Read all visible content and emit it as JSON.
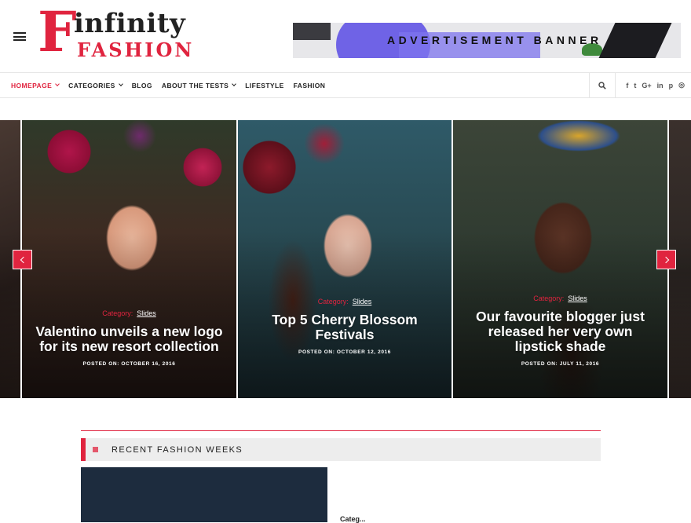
{
  "header": {
    "logo_letter": "F",
    "logo_word1": "infinity",
    "logo_word2": "FASHION",
    "ad_text": "ADVERTISEMENT BANNER"
  },
  "nav": {
    "items": [
      {
        "label": "HOMEPAGE",
        "dropdown": true,
        "active": true
      },
      {
        "label": "CATEGORIES",
        "dropdown": true
      },
      {
        "label": "BLOG"
      },
      {
        "label": "ABOUT THE TESTS",
        "dropdown": true
      },
      {
        "label": "LIFESTYLE"
      },
      {
        "label": "FASHION"
      }
    ],
    "social_icons": [
      "facebook-icon",
      "twitter-icon",
      "google-plus-icon",
      "linkedin-icon",
      "pinterest-icon",
      "instagram-icon"
    ],
    "social_glyphs": [
      "f",
      "t",
      "G+",
      "in",
      "p",
      "◎"
    ]
  },
  "slider": {
    "slides": [
      {
        "category_prefix": "Category:",
        "category": "Slides",
        "title": "Valentino unveils a new logo for its new resort collection",
        "posted": "POSTED ON: OCTOBER 16, 2016"
      },
      {
        "category_prefix": "Category:",
        "category": "Slides",
        "title": "Top 5 Cherry Blossom Festivals",
        "posted": "POSTED ON: OCTOBER 12, 2016"
      },
      {
        "category_prefix": "Category:",
        "category": "Slides",
        "title": "Our favourite blogger just released her very own lipstick shade",
        "posted": "POSTED ON: JULY 11, 2016"
      }
    ]
  },
  "section": {
    "heading": "RECENT FASHION WEEKS",
    "side_category": "Categ..."
  },
  "colors": {
    "accent": "#e0243f",
    "nav_text": "#222222",
    "section_bar": "#ededed"
  }
}
